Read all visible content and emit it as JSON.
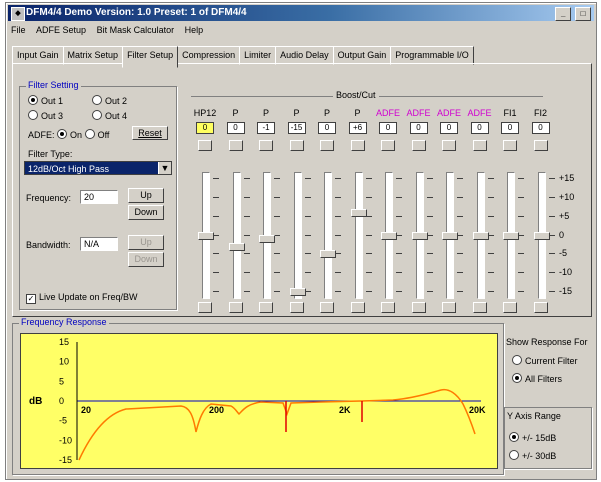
{
  "window": {
    "title": "DFM4/4 Demo  Version: 1.0  Preset: 1 of DFM4/4",
    "buttons": [
      "_",
      "□"
    ]
  },
  "menu": [
    "File",
    "ADFE Setup",
    "Bit Mask Calculator",
    "Help"
  ],
  "tabs": [
    "Input Gain",
    "Matrix Setup",
    "Filter Setup",
    "Compression",
    "Limiter",
    "Audio Delay",
    "Output Gain",
    "Programmable I/O"
  ],
  "active_tab": "Filter Setup",
  "filter_setting": {
    "title": "Filter Setting",
    "outputs": [
      {
        "label": "Out 1",
        "selected": true
      },
      {
        "label": "Out 2",
        "selected": false
      },
      {
        "label": "Out 3",
        "selected": false
      },
      {
        "label": "Out 4",
        "selected": false
      }
    ],
    "adfe_label": "ADFE:",
    "adfe_on": "On",
    "adfe_off": "Off",
    "reset_label": "Reset",
    "filter_type_label": "Filter Type:",
    "filter_type_value": "12dB/Oct High Pass",
    "frequency_label": "Frequency:",
    "frequency_value": "20",
    "up_label": "Up",
    "down_label": "Down",
    "bandwidth_label": "Bandwidth:",
    "bandwidth_value": "N/A",
    "live_update_label": "Live Update on Freq/BW"
  },
  "boost_cut": {
    "title": "Boost/Cut",
    "columns": [
      {
        "label": "HP12",
        "value": "0",
        "magenta": false,
        "highlight": true,
        "level_db": 0
      },
      {
        "label": "P",
        "value": "0",
        "magenta": false,
        "highlight": false,
        "level_db": -3
      },
      {
        "label": "P",
        "value": "-1",
        "magenta": false,
        "highlight": false,
        "level_db": -1
      },
      {
        "label": "P",
        "value": "-15",
        "magenta": false,
        "highlight": false,
        "level_db": -15
      },
      {
        "label": "P",
        "value": "0",
        "magenta": false,
        "highlight": false,
        "level_db": -5
      },
      {
        "label": "P",
        "value": "+6",
        "magenta": false,
        "highlight": false,
        "level_db": 6
      },
      {
        "label": "ADFE",
        "value": "0",
        "magenta": true,
        "highlight": false,
        "level_db": 0
      },
      {
        "label": "ADFE",
        "value": "0",
        "magenta": true,
        "highlight": false,
        "level_db": 0
      },
      {
        "label": "ADFE",
        "value": "0",
        "magenta": true,
        "highlight": false,
        "level_db": 0
      },
      {
        "label": "ADFE",
        "value": "0",
        "magenta": true,
        "highlight": false,
        "level_db": 0
      },
      {
        "label": "FI1",
        "value": "0",
        "magenta": false,
        "highlight": false,
        "level_db": 0
      },
      {
        "label": "FI2",
        "value": "0",
        "magenta": false,
        "highlight": false,
        "level_db": 0
      }
    ],
    "scale_labels": [
      "+15",
      "+10",
      "+5",
      "0",
      "-5",
      "-10",
      "-15"
    ]
  },
  "frequency_response": {
    "title": "Frequency Response",
    "y_axis_label": "dB",
    "y_ticks": [
      "15",
      "10",
      "5",
      "0",
      "-5",
      "-10",
      "-15"
    ],
    "x_ticks": [
      "20",
      "200",
      "2K",
      "20K"
    ],
    "background": "#ffff66",
    "curve_color": "#ff7a00",
    "marker_color": "#e00000"
  },
  "show_response": {
    "title": "Show Response For",
    "options": [
      {
        "label": "Current Filter",
        "selected": false
      },
      {
        "label": "All Filters",
        "selected": true
      }
    ]
  },
  "y_axis_range": {
    "title": "Y Axis Range",
    "options": [
      {
        "label": "+/- 15dB",
        "selected": true
      },
      {
        "label": "+/- 30dB",
        "selected": false
      }
    ]
  }
}
